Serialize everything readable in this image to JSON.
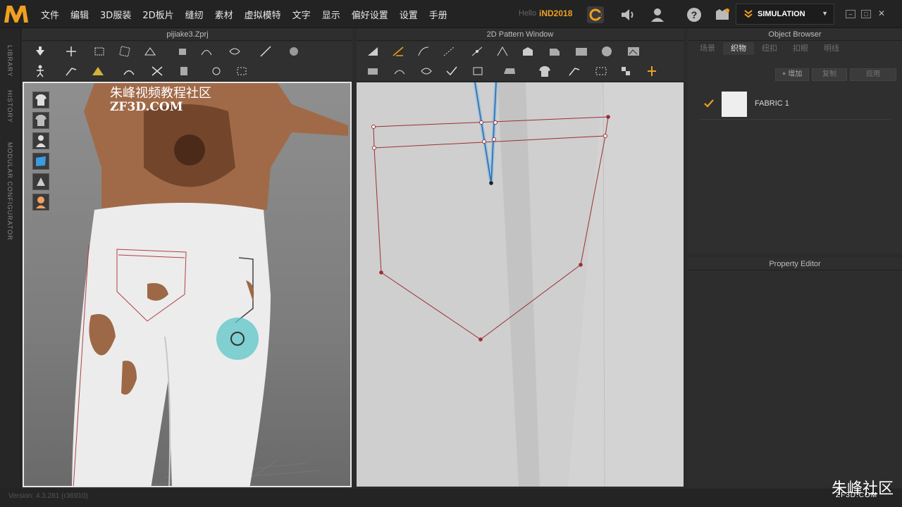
{
  "app": {
    "logo": "marvelous-designer-logo"
  },
  "menu": [
    "文件",
    "编辑",
    "3D服装",
    "2D板片",
    "缝纫",
    "素材",
    "虚拟模特",
    "文字",
    "显示",
    "偏好设置",
    "设置",
    "手册"
  ],
  "account": {
    "hello": "Hello",
    "user": "iND2018"
  },
  "simulation": {
    "label": "SIMULATION"
  },
  "rail": {
    "library": "LIBRARY",
    "history": "HISTORY",
    "modular": "MODULAR CONFIGURATOR"
  },
  "view3d": {
    "title": "pijiake3.Zprj",
    "watermark_cn": "朱峰视频教程社区",
    "watermark_en": "ZF3D.COM"
  },
  "view2d": {
    "title": "2D Pattern Window"
  },
  "object_browser": {
    "title": "Object Browser",
    "tabs": [
      "场景",
      "织物",
      "纽扣",
      "扣眼",
      "明线"
    ],
    "active_tab": "织物",
    "buttons": {
      "add": "+ 增加",
      "copy": "复制",
      "apply": "应用"
    },
    "fabrics": [
      {
        "name": "FABRIC 1",
        "color": "#eeeeee"
      }
    ]
  },
  "property_editor": {
    "title": "Property Editor"
  },
  "status": {
    "version": "Version: 4.3.281 (r36910)"
  },
  "brand": {
    "cn": "朱峰社区",
    "en": "ZF3D.COM"
  },
  "colors": {
    "accent": "#f0a020",
    "pattern_line": "#9a2f36",
    "selected_line": "#3a86c8"
  }
}
